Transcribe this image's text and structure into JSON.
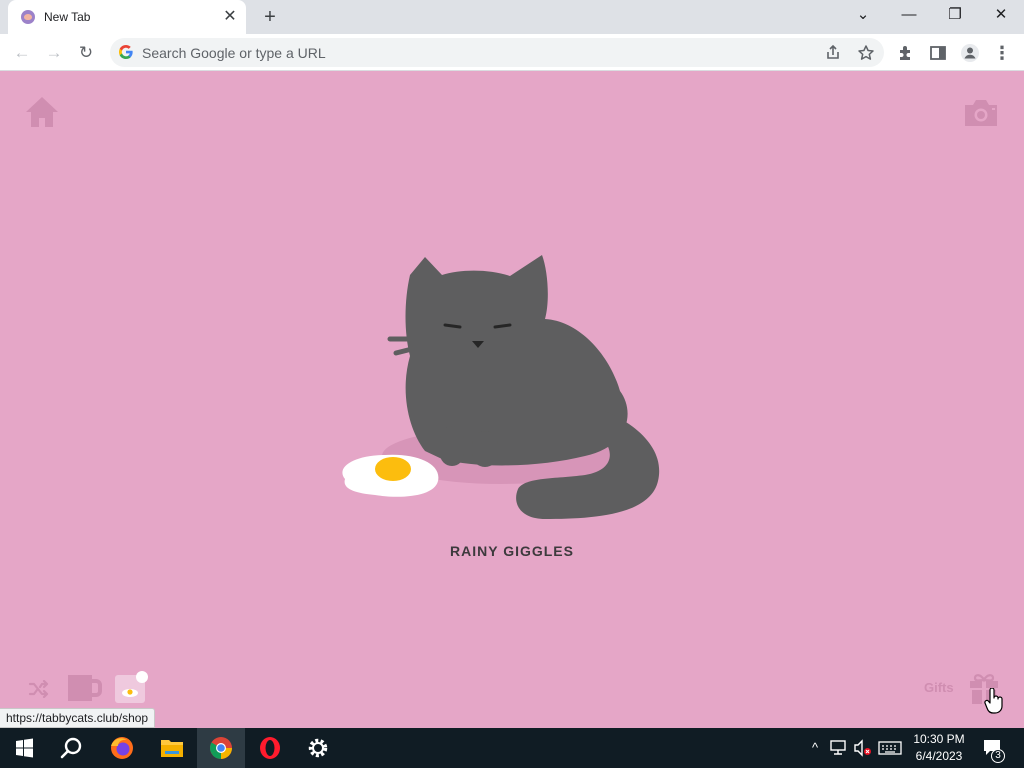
{
  "browser": {
    "tab": {
      "title": "New Tab",
      "close": "✕"
    },
    "new_tab": "+",
    "window_controls": {
      "tab_search": "⌄",
      "minimize": "—",
      "restore": "❐",
      "close": "✕"
    },
    "nav": {
      "back": "←",
      "forward": "→",
      "reload": "↻"
    },
    "omnibox": {
      "placeholder": "Search Google or type a URL",
      "value": ""
    },
    "toolbar_icons": [
      "share-icon",
      "star-icon",
      "extensions-icon",
      "side-panel-icon",
      "profile-icon",
      "menu-icon"
    ],
    "menu_glyph": "⋮"
  },
  "page": {
    "cat_name": "RAINY GIGGLES",
    "gifts_label": "Gifts",
    "status_url": "https://tabbycats.club/shop",
    "colors": {
      "background": "#e5a6c7",
      "cat": "#5e5e5f",
      "icon": "#d08eb1",
      "yolk": "#fcbd0e"
    }
  },
  "taskbar": {
    "apps": [
      "start-icon",
      "search-icon",
      "firefox-icon",
      "file-explorer-icon",
      "chrome-icon",
      "opera-icon",
      "settings-icon"
    ],
    "tray": {
      "chevron": "^",
      "notification_count": "3"
    },
    "clock": {
      "time": "10:30 PM",
      "date": "6/4/2023"
    }
  }
}
